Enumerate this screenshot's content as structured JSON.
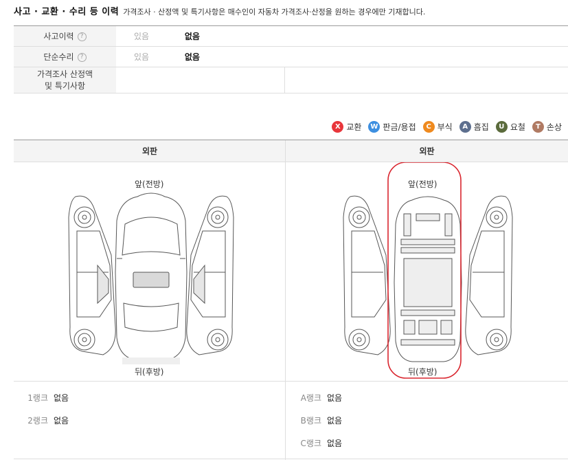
{
  "header": {
    "title": "사고 · 교환 · 수리 등 이력",
    "subtitle": "가격조사 · 산정액 및 특기사항은 매수인이 자동차 가격조사·산정을 원하는 경우에만 기재합니다."
  },
  "info_table": {
    "rows": [
      {
        "label": "사고이력",
        "opt_yes": "있음",
        "opt_no": "없음"
      },
      {
        "label": "단순수리",
        "opt_yes": "있음",
        "opt_no": "없음"
      }
    ],
    "price_label_line1": "가격조사 산정액",
    "price_label_line2": "및 특기사항",
    "help_glyph": "?"
  },
  "legend": [
    {
      "code": "X",
      "label": "교환",
      "color": "#e8363b"
    },
    {
      "code": "W",
      "label": "판금/용접",
      "color": "#3d8fe0"
    },
    {
      "code": "C",
      "label": "부식",
      "color": "#ef8a1f"
    },
    {
      "code": "A",
      "label": "흠집",
      "color": "#5d6f8e"
    },
    {
      "code": "U",
      "label": "요철",
      "color": "#5b6b3c"
    },
    {
      "code": "T",
      "label": "손상",
      "color": "#b07a63"
    }
  ],
  "panel": {
    "left_header": "외판",
    "right_header": "외판",
    "front_label": "앞(전방)",
    "back_label": "뒤(후방)",
    "highlight_color": "#d9252e"
  },
  "ranks_left": [
    {
      "rank": "1랭크",
      "value": "없음"
    },
    {
      "rank": "2랭크",
      "value": "없음"
    }
  ],
  "ranks_right": [
    {
      "rank": "A랭크",
      "value": "없음"
    },
    {
      "rank": "B랭크",
      "value": "없음"
    },
    {
      "rank": "C랭크",
      "value": "없음"
    }
  ]
}
